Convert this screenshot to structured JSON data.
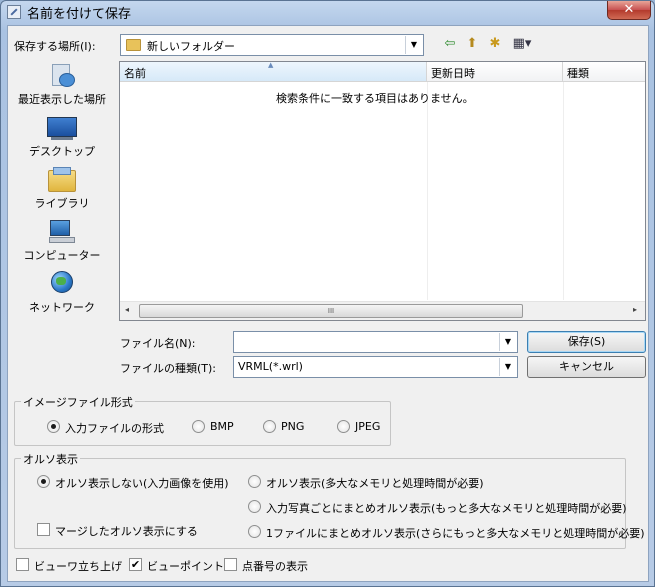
{
  "window": {
    "title": "名前を付けて保存",
    "close_glyph": "✕"
  },
  "location": {
    "label": "保存する場所(I):",
    "value": "新しいフォルダー"
  },
  "toolbar": {
    "back_glyph": "⇦",
    "up_glyph": "⬆",
    "new_folder_glyph": "✱",
    "view_glyph": "▦▾"
  },
  "places": [
    {
      "label": "最近表示した場所",
      "icon": "recent-places-icon"
    },
    {
      "label": "デスクトップ",
      "icon": "desktop-icon"
    },
    {
      "label": "ライブラリ",
      "icon": "libraries-icon"
    },
    {
      "label": "コンピューター",
      "icon": "computer-icon"
    },
    {
      "label": "ネットワーク",
      "icon": "network-icon"
    }
  ],
  "filelist": {
    "columns": [
      "名前",
      "更新日時",
      "種類"
    ],
    "empty_message": "検索条件に一致する項目はありません。",
    "scroll_left": "◂",
    "scroll_right": "▸",
    "thumb_grip": "III"
  },
  "filename": {
    "label": "ファイル名(N):",
    "value": ""
  },
  "filetype": {
    "label": "ファイルの種類(T):",
    "value": "VRML(*.wrl)"
  },
  "buttons": {
    "save": "保存(S)",
    "cancel": "キャンセル"
  },
  "image_format": {
    "title": "イメージファイル形式",
    "options": [
      {
        "label": "入力ファイルの形式",
        "selected": true
      },
      {
        "label": "BMP",
        "selected": false
      },
      {
        "label": "PNG",
        "selected": false
      },
      {
        "label": "JPEG",
        "selected": false
      }
    ]
  },
  "ortho": {
    "title": "オルソ表示",
    "options": [
      {
        "label": "オルソ表示しない(入力画像を使用)",
        "selected": true
      },
      {
        "label": "オルソ表示(多大なメモリと処理時間が必要)",
        "selected": false
      },
      {
        "label": "入力写真ごとにまとめオルソ表示(もっと多大なメモリと処理時間が必要)",
        "selected": false
      },
      {
        "label": "1ファイルにまとめオルソ表示(さらにもっと多大なメモリと処理時間が必要)",
        "selected": false
      }
    ],
    "merge_check": {
      "label": "マージしたオルソ表示にする",
      "checked": false
    }
  },
  "bottom_checks": [
    {
      "label": "ビューワ立ち上げ",
      "checked": false
    },
    {
      "label": "ビューポイント",
      "checked": true
    },
    {
      "label": "点番号の表示",
      "checked": false
    }
  ],
  "check_glyph": "✔",
  "drop_glyph": "▼",
  "sort_glyph": "▲",
  "colors": {
    "accent": "#3c7fb1",
    "title_bar": "#b7cbe6",
    "close": "#c75050"
  }
}
